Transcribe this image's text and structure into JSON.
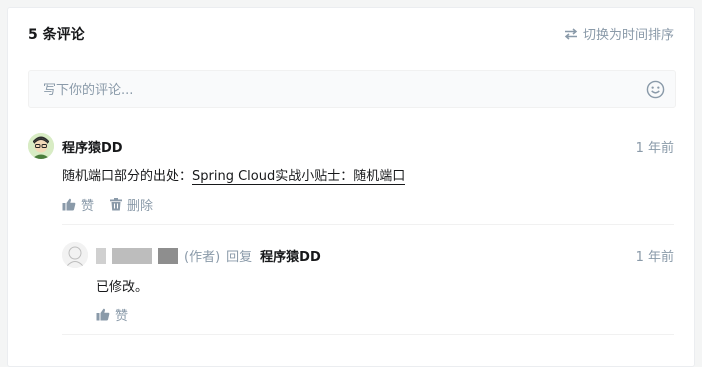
{
  "header": {
    "count_label": "5 条评论",
    "sort_label": "切换为时间排序",
    "sort_icon": "swap-icon"
  },
  "editor": {
    "placeholder": "写下你的评论...",
    "emoji_icon": "smile-icon"
  },
  "comments": [
    {
      "author": "程序猿DD",
      "time": "1 年前",
      "text_prefix": "随机端口部分的出处：",
      "link_text": "Spring Cloud实战小贴士：随机端口",
      "actions": {
        "like": "赞",
        "delete": "删除"
      },
      "replies": [
        {
          "role": "(作者)",
          "reply_word": "回复",
          "reply_to": "程序猿DD",
          "time": "1 年前",
          "text": "已修改。",
          "actions": {
            "like": "赞"
          }
        }
      ]
    }
  ],
  "colors": {
    "muted": "#8a9aa9",
    "text": "#17181a",
    "border": "#ebedf0"
  }
}
